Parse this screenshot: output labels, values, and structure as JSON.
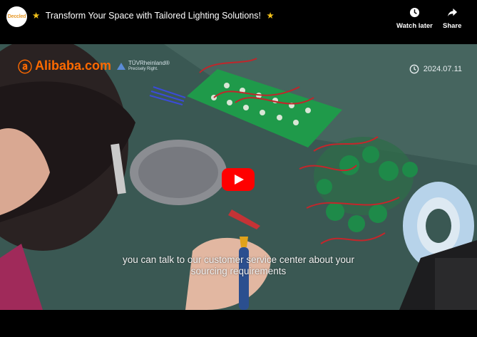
{
  "title_bar": {
    "channel_avatar_text": "Deccled",
    "star_left": "★",
    "title": "Transform Your Space with Tailored Lighting Solutions!",
    "star_right": "★",
    "watch_later_label": "Watch later",
    "share_label": "Share"
  },
  "video": {
    "logo_text": "Alibaba.com",
    "certification_line1": "TÜVRheinland®",
    "certification_line2": "Precisely Right.",
    "date": "2024.07.11",
    "caption_line1": "you can talk to our customer service center about your",
    "caption_line2": "sourcing requirements"
  },
  "colors": {
    "play_button": "#ff0000",
    "alibaba_orange": "#ff6a00",
    "star": "#f3c21a"
  },
  "icons": [
    "clock-icon",
    "share-arrow-icon",
    "play-icon",
    "clock-small-icon"
  ]
}
